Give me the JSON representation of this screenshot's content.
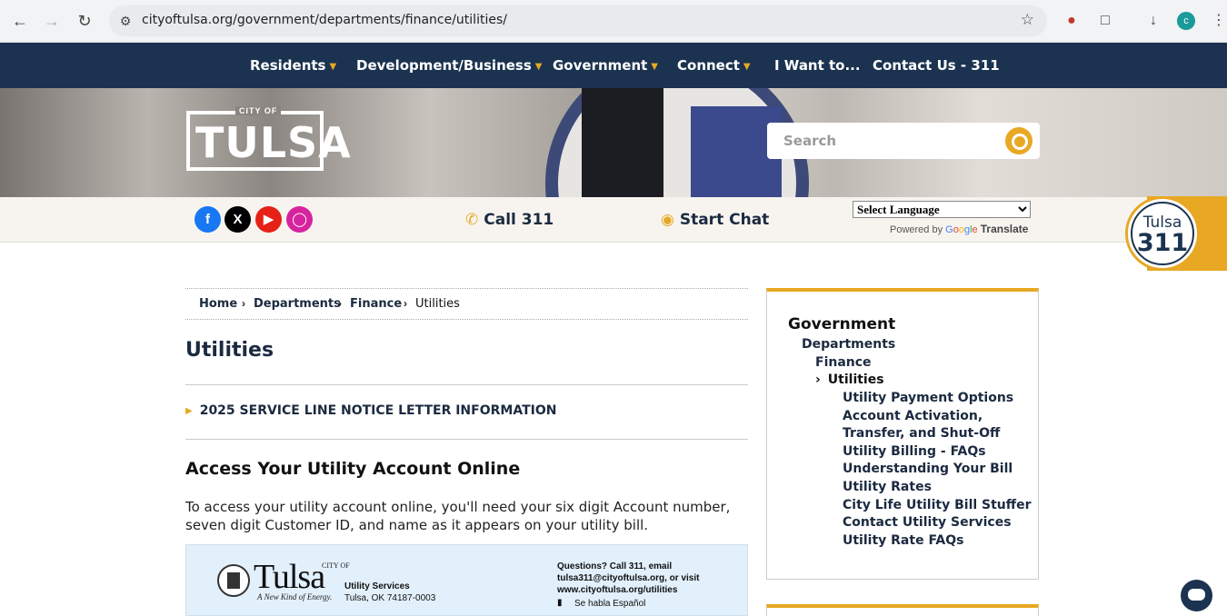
{
  "browser": {
    "url": "cityoftulsa.org/government/departments/finance/utilities/",
    "profile_initial": "c"
  },
  "nav": {
    "items": [
      {
        "label": "Residents",
        "has_menu": true
      },
      {
        "label": "Development/Business",
        "has_menu": true
      },
      {
        "label": "Government",
        "has_menu": true
      },
      {
        "label": "Connect",
        "has_menu": true
      },
      {
        "label": "I Want to...",
        "has_menu": false
      },
      {
        "label": "Contact Us - 311",
        "has_menu": false
      }
    ]
  },
  "header": {
    "logo_small": "CITY OF",
    "logo_large": "TULSA",
    "search_placeholder": "Search"
  },
  "utility_bar": {
    "call_label": "Call 311",
    "chat_label": "Start Chat",
    "language_select": "Select Language",
    "powered_by": "Powered by",
    "google": "Google",
    "translate": "Translate",
    "badge_line1": "Tulsa",
    "badge_line2": "311"
  },
  "breadcrumb": [
    {
      "label": "Home",
      "link": true
    },
    {
      "label": "Departments",
      "link": true
    },
    {
      "label": "Finance",
      "link": true
    },
    {
      "label": "Utilities",
      "link": false
    }
  ],
  "main": {
    "title": "Utilities",
    "accordion_label": "2025 SERVICE LINE NOTICE LETTER INFORMATION",
    "section_heading": "Access Your Utility Account Online",
    "paragraph": "To access your utility account online, you'll need your six digit Account number, seven digit Customer ID, and name as it appears on your utility bill."
  },
  "bill_image": {
    "city_of": "CITY OF",
    "tulsa": "Tulsa",
    "tagline": "A New Kind of Energy.",
    "dept": "Utility Services",
    "address": "Tulsa, OK 74187-0003",
    "questions": "Questions?  Call 311, email tulsa311@cityoftulsa.org, or visit www.cityoftulsa.org/utilities",
    "espanol": "Se habla Español"
  },
  "sidebar": {
    "level1": "Government",
    "level2": "Departments",
    "level3": "Finance",
    "level4": "Utilities",
    "children": [
      "Utility Payment Options",
      "Account Activation,",
      "Transfer, and Shut-Off",
      "Utility Billing - FAQs",
      "Understanding Your Bill",
      "Utility Rates",
      "City Life Utility Bill Stuffer",
      "Contact Utility Services",
      "Utility Rate FAQs"
    ]
  },
  "colors": {
    "nav_bg": "#1b3350",
    "accent": "#e8a824",
    "text_dark": "#1b2a40"
  }
}
